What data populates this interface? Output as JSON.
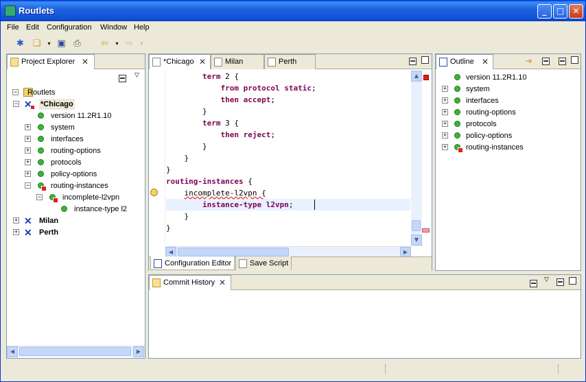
{
  "window": {
    "title": "Routlets"
  },
  "menu": [
    "File",
    "Edit",
    "Configuration",
    "Window",
    "Help"
  ],
  "project_explorer": {
    "title": "Project Explorer",
    "tree": [
      {
        "label": "Routlets",
        "level": 0,
        "type": "root",
        "expanded": true
      },
      {
        "label": "*Chicago",
        "level": 1,
        "type": "router-error",
        "expanded": true,
        "selected": true
      },
      {
        "label": "version 11.2R1.10",
        "level": 2,
        "type": "leaf"
      },
      {
        "label": "system",
        "level": 2,
        "type": "collapsed"
      },
      {
        "label": "interfaces",
        "level": 2,
        "type": "collapsed"
      },
      {
        "label": "routing-options",
        "level": 2,
        "type": "collapsed"
      },
      {
        "label": "protocols",
        "level": 2,
        "type": "collapsed"
      },
      {
        "label": "policy-options",
        "level": 2,
        "type": "collapsed"
      },
      {
        "label": "routing-instances",
        "level": 2,
        "type": "expanded-error"
      },
      {
        "label": "incomplete-l2vpn",
        "level": 3,
        "type": "expanded-error"
      },
      {
        "label": "instance-type l2",
        "level": 4,
        "type": "leaf"
      },
      {
        "label": "Milan",
        "level": 1,
        "type": "router",
        "expanded": false
      },
      {
        "label": "Perth",
        "level": 1,
        "type": "router",
        "expanded": false
      }
    ]
  },
  "editor": {
    "tabs": [
      {
        "label": "*Chicago",
        "active": true
      },
      {
        "label": "Milan"
      },
      {
        "label": "Perth"
      }
    ],
    "lines": [
      {
        "indent": 2,
        "parts": [
          [
            "kw",
            "term"
          ],
          [
            "plain",
            " 2 {"
          ]
        ]
      },
      {
        "indent": 3,
        "parts": [
          [
            "kw",
            "from protocol static"
          ],
          [
            "plain",
            ";"
          ]
        ]
      },
      {
        "indent": 3,
        "parts": [
          [
            "kw",
            "then accept"
          ],
          [
            "plain",
            ";"
          ]
        ]
      },
      {
        "indent": 2,
        "parts": [
          [
            "plain",
            "}"
          ]
        ]
      },
      {
        "indent": 2,
        "parts": [
          [
            "kw",
            "term"
          ],
          [
            "plain",
            " 3 {"
          ]
        ]
      },
      {
        "indent": 3,
        "parts": [
          [
            "kw",
            "then reject"
          ],
          [
            "plain",
            ";"
          ]
        ]
      },
      {
        "indent": 2,
        "parts": [
          [
            "plain",
            "}"
          ]
        ]
      },
      {
        "indent": 1,
        "parts": [
          [
            "plain",
            "}"
          ]
        ]
      },
      {
        "indent": 0,
        "parts": [
          [
            "plain",
            "}"
          ]
        ]
      },
      {
        "indent": 0,
        "parts": [
          [
            "kw",
            "routing-instances"
          ],
          [
            "plain",
            " {"
          ]
        ]
      },
      {
        "indent": 1,
        "parts": [
          [
            "plain",
            "incomplete-l2vpn {"
          ]
        ]
      },
      {
        "indent": 2,
        "parts": [
          [
            "kw",
            "instance-type l2vpn"
          ],
          [
            "plain",
            ";"
          ]
        ]
      },
      {
        "indent": 1,
        "parts": [
          [
            "plain",
            "}"
          ]
        ]
      },
      {
        "indent": 0,
        "parts": [
          [
            "plain",
            "}"
          ]
        ]
      }
    ],
    "bottom_tabs": [
      {
        "label": "Configuration Editor",
        "active": true
      },
      {
        "label": "Save Script"
      }
    ]
  },
  "outline": {
    "title": "Outline",
    "items": [
      {
        "label": "version 11.2R1.10",
        "type": "leaf"
      },
      {
        "label": "system",
        "type": "collapsed"
      },
      {
        "label": "interfaces",
        "type": "collapsed"
      },
      {
        "label": "routing-options",
        "type": "collapsed"
      },
      {
        "label": "protocols",
        "type": "collapsed"
      },
      {
        "label": "policy-options",
        "type": "collapsed"
      },
      {
        "label": "routing-instances",
        "type": "collapsed-error"
      }
    ]
  },
  "commit_history": {
    "title": "Commit History"
  },
  "colors": {
    "keyword": "#7f0055",
    "highlight_line": "#e8f2fe",
    "title_bar": "#0a5ee4",
    "ok_dot": "#3cb33c",
    "error": "#d22222"
  }
}
